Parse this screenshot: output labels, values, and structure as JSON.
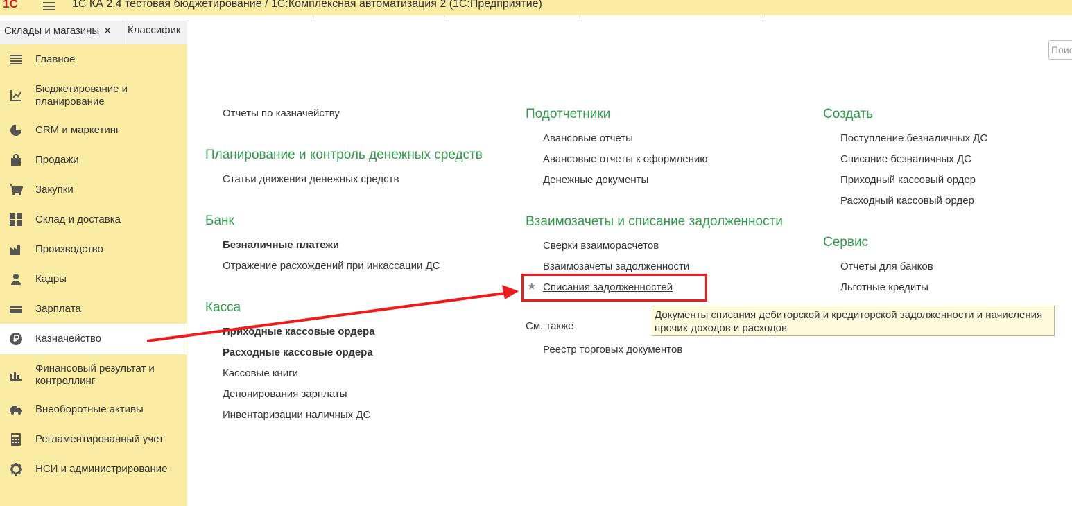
{
  "window": {
    "logo": "1С",
    "title": "1С КА 2.4 тестовая бюджетирование / 1С:Комплексная автоматизация 2  (1С:Предприятие)"
  },
  "tabs": [
    {
      "label": "Склады и магазины",
      "close": "✕"
    },
    {
      "label": "Классифик"
    }
  ],
  "search": {
    "placeholder": "Поис"
  },
  "sidebar": {
    "items": [
      {
        "label": "Главное",
        "icon": "menu-lines-icon"
      },
      {
        "label": "Бюджетирование и\nпланирование",
        "icon": "chart-axes-icon"
      },
      {
        "label": "CRM и маркетинг",
        "icon": "pie-chart-icon"
      },
      {
        "label": "Продажи",
        "icon": "shopping-bag-icon"
      },
      {
        "label": "Закупки",
        "icon": "shopping-cart-icon"
      },
      {
        "label": "Склад и доставка",
        "icon": "warehouse-grid-icon"
      },
      {
        "label": "Производство",
        "icon": "factory-icon"
      },
      {
        "label": "Кадры",
        "icon": "person-icon"
      },
      {
        "label": "Зарплата",
        "icon": "wallet-icon"
      },
      {
        "label": "Казначейство",
        "icon": "ruble-icon",
        "active": true
      },
      {
        "label": "Финансовый результат и\nконтроллинг",
        "icon": "bar-chart-icon"
      },
      {
        "label": "Внеоборотные активы",
        "icon": "truck-icon"
      },
      {
        "label": "Регламентированный учет",
        "icon": "calculator-icon"
      },
      {
        "label": "НСИ и администрирование",
        "icon": "gear-icon"
      }
    ]
  },
  "col1": {
    "top_link": "Отчеты по казначейству",
    "planning_heading": "Планирование и контроль денежных средств",
    "planning_links": [
      "Статьи движения денежных средств"
    ],
    "bank_heading": "Банк",
    "bank_links": [
      "Безналичные платежи",
      "Отражение расхождений при инкассации ДС"
    ],
    "cash_heading": "Касса",
    "cash_links": [
      "Приходные кассовые ордера",
      "Расходные кассовые ордера",
      "Кассовые книги",
      "Депонирования зарплаты",
      "Инвентаризации наличных ДС"
    ]
  },
  "col2": {
    "accountable_heading": "Подотчетники",
    "accountable_links": [
      "Авансовые отчеты",
      "Авансовые отчеты к оформлению",
      "Денежные документы"
    ],
    "offsets_heading": "Взаимозачеты и списание задолженности",
    "offsets_links": [
      "Сверки взаиморасчетов",
      "Взаимозачеты задолженности"
    ],
    "writeoff_link": "Списания задолженностей",
    "star": "★",
    "see_also": "См. также",
    "see_also_links": [
      "Реестр торговых документов"
    ]
  },
  "col3": {
    "create_heading": "Создать",
    "create_links": [
      "Поступление безналичных ДС",
      "Списание безналичных ДС",
      "Приходный кассовый ордер",
      "Расходный кассовый ордер"
    ],
    "service_heading": "Сервис",
    "service_links": [
      "Отчеты для банков",
      "Льготные кредиты"
    ]
  },
  "tooltip": {
    "text": "Документы списания дебиторской и кредиторской задолженности и начисления прочих доходов и расходов"
  },
  "colors": {
    "sidebar_bg": "#fbeca4",
    "heading_green": "#2f9a49",
    "highlight_red": "#ee1c1c"
  }
}
